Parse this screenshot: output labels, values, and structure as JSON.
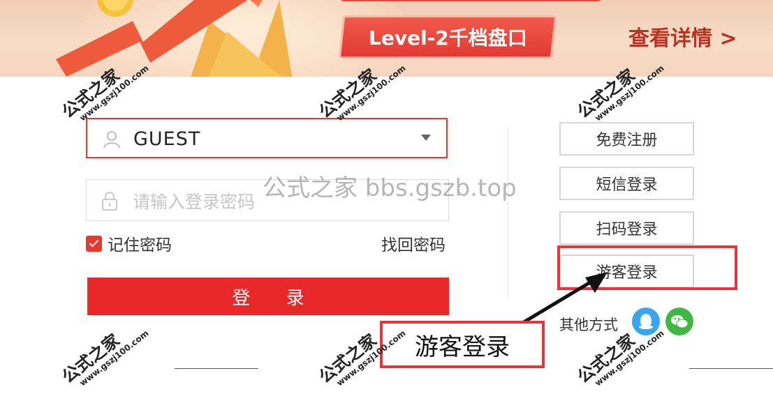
{
  "banner": {
    "level_label": "Level-2千档盘口",
    "detail_link": "查看详情 >"
  },
  "login_form": {
    "username_value": "GUEST",
    "password_placeholder": "请输入登录密码",
    "remember_label": "记住密码",
    "remember_checked": true,
    "forgot_link": "找回密码",
    "login_button": "登 录"
  },
  "side_options": {
    "register": "免费注册",
    "sms_login": "短信登录",
    "scan_login": "扫码登录",
    "guest_login": "游客登录",
    "other_methods_label": "其他方式"
  },
  "annotation": {
    "callout_text": "游客登录",
    "highlight_color": "#e8343b"
  },
  "watermark": {
    "center_text": "公式之家 bbs.gszb.top",
    "site_name": "公式之家",
    "site_url": "www.gszj100.com"
  },
  "colors": {
    "accent": "#e8282b",
    "qq": "#3aa4ee",
    "wechat": "#41b743"
  }
}
